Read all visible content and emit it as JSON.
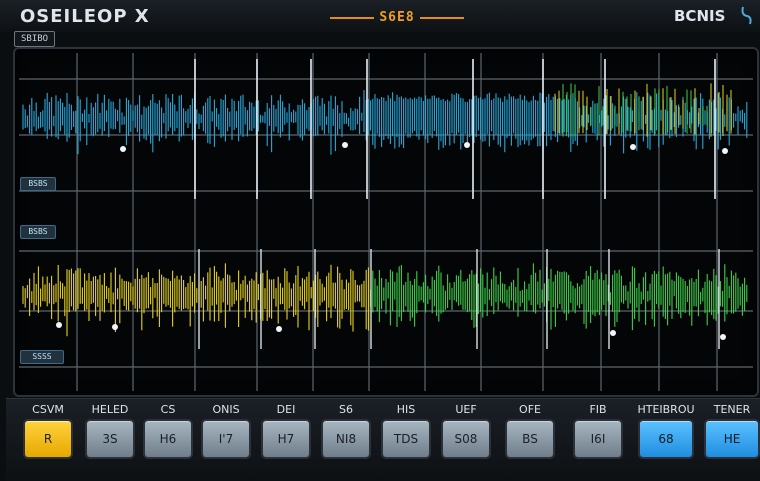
{
  "header": {
    "app_title": "OSEILEOP X",
    "center_readout": "S6E8",
    "right_label": "BCNIS",
    "sublabel": "SBIBO"
  },
  "scope": {
    "channel_tags": [
      "BSBS",
      "BSBS",
      "SSSS"
    ],
    "colors": {
      "cyan": "#2aa8d8",
      "yellow": "#e6d21e",
      "green": "#3fcf4a",
      "grid": "#5c6770"
    }
  },
  "controls": [
    {
      "label": "CSVM",
      "value": "R",
      "style": "yellow"
    },
    {
      "label": "HELED",
      "value": "3S",
      "style": "gray"
    },
    {
      "label": "CS",
      "value": "H6",
      "style": "gray"
    },
    {
      "label": "ONIS",
      "value": "I'7",
      "style": "gray"
    },
    {
      "label": "DEI",
      "value": "H7",
      "style": "gray"
    },
    {
      "label": "S6",
      "value": "NI8",
      "style": "gray"
    },
    {
      "label": "HIS",
      "value": "TDS",
      "style": "gray"
    },
    {
      "label": "UEF",
      "value": "S08",
      "style": "gray"
    },
    {
      "label": "OFE",
      "value": "BS",
      "style": "gray"
    },
    {
      "label": "FIB",
      "value": "I6I",
      "style": "gray"
    },
    {
      "label": "HTEIBROU",
      "value": "68",
      "style": "blue"
    },
    {
      "label": "TENER",
      "value": "HE",
      "style": "blue"
    }
  ]
}
